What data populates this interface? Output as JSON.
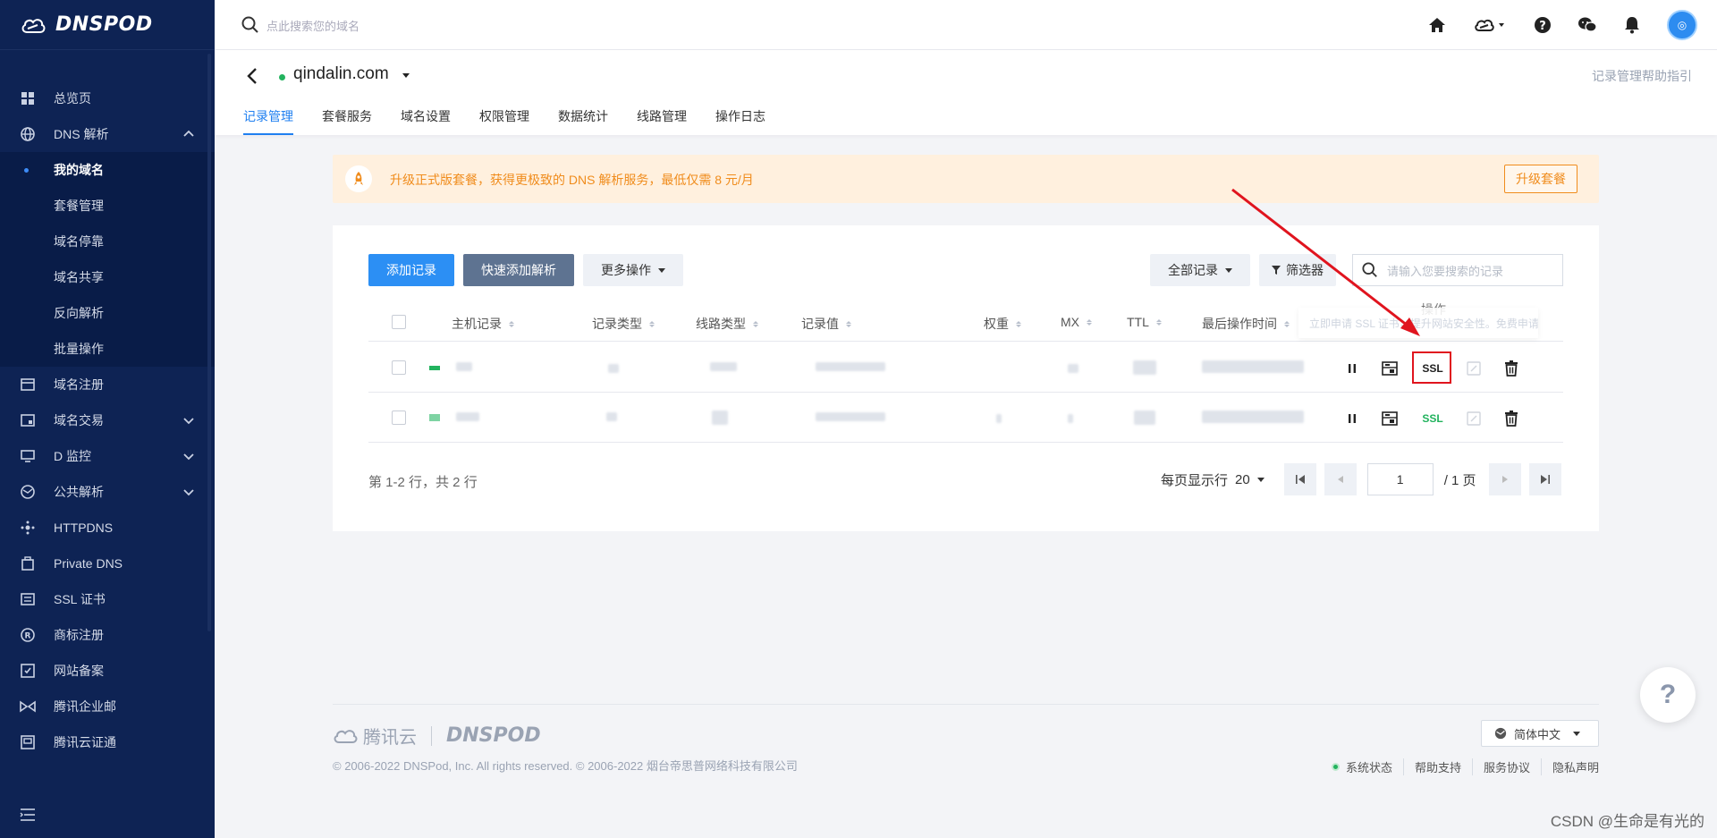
{
  "brand": {
    "name": "DNSPOD"
  },
  "search": {
    "placeholder": "点此搜索您的域名"
  },
  "sidebar": {
    "items": [
      {
        "label": "总览页",
        "icon": "dashboard-icon"
      },
      {
        "label": "DNS 解析",
        "icon": "globe-icon",
        "expanded": true
      },
      {
        "label": "域名注册",
        "icon": "domain-register-icon"
      },
      {
        "label": "域名交易",
        "icon": "domain-trade-icon"
      },
      {
        "label": "D 监控",
        "icon": "monitor-icon"
      },
      {
        "label": "公共解析",
        "icon": "public-dns-icon"
      },
      {
        "label": "HTTPDNS",
        "icon": "httpdns-icon"
      },
      {
        "label": "Private DNS",
        "icon": "private-dns-icon"
      },
      {
        "label": "SSL 证书",
        "icon": "ssl-cert-icon"
      },
      {
        "label": "商标注册",
        "icon": "trademark-icon"
      },
      {
        "label": "网站备案",
        "icon": "icp-filing-icon"
      },
      {
        "label": "腾讯企业邮",
        "icon": "enterprise-mail-icon"
      },
      {
        "label": "腾讯云证通",
        "icon": "cert-id-icon"
      }
    ],
    "dns_sub": [
      {
        "label": "我的域名",
        "active": true
      },
      {
        "label": "套餐管理"
      },
      {
        "label": "域名停靠"
      },
      {
        "label": "域名共享"
      },
      {
        "label": "反向解析"
      },
      {
        "label": "批量操作"
      }
    ]
  },
  "domain": {
    "name": "qindalin.com",
    "status_color": "#22b35e",
    "help_link": "记录管理帮助指引",
    "tabs": [
      "记录管理",
      "套餐服务",
      "域名设置",
      "权限管理",
      "数据统计",
      "线路管理",
      "操作日志"
    ],
    "active_tab": 0
  },
  "banner": {
    "text": "升级正式版套餐，获得更极致的 DNS 解析服务，最低仅需 8 元/月",
    "button": "升级套餐",
    "color": "#f08c1c"
  },
  "toolbar": {
    "add_record": "添加记录",
    "quick_add": "快速添加解析",
    "more_actions": "更多操作",
    "all_records": "全部记录",
    "filter": "筛选器",
    "search_placeholder": "请输入您要搜索的记录"
  },
  "table": {
    "columns": [
      "主机记录",
      "记录类型",
      "线路类型",
      "记录值",
      "权重",
      "MX",
      "TTL",
      "最后操作时间",
      "操作"
    ],
    "tooltip": "立即申请 SSL 证书，提升网站安全性。免费申请",
    "ssl_label": "SSL",
    "rows": [
      {
        "status_color": "#22b35e",
        "ssl_color": "#222222",
        "highlighted": true
      },
      {
        "status_color": "#7ed3a3",
        "ssl_color": "#22b35e",
        "highlighted": false
      }
    ]
  },
  "pagination": {
    "summary": "第 1-2 行，共 2 行",
    "per_page_label": "每页显示行",
    "per_page": "20",
    "current_page": "1",
    "total_pages": "/ 1 页"
  },
  "footer": {
    "logo_tencent": "腾讯云",
    "logo_dnspod": "DNSPOD",
    "copyright": "© 2006-2022 DNSPod, Inc. All rights reserved. © 2006-2022 烟台帝思普网络科技有限公司",
    "language": "简体中文",
    "links": [
      "系统状态",
      "帮助支持",
      "服务协议",
      "隐私声明"
    ]
  },
  "help_bubble": "?",
  "watermark": "CSDN @生命是有光的",
  "annotation_color": "#e0141e"
}
